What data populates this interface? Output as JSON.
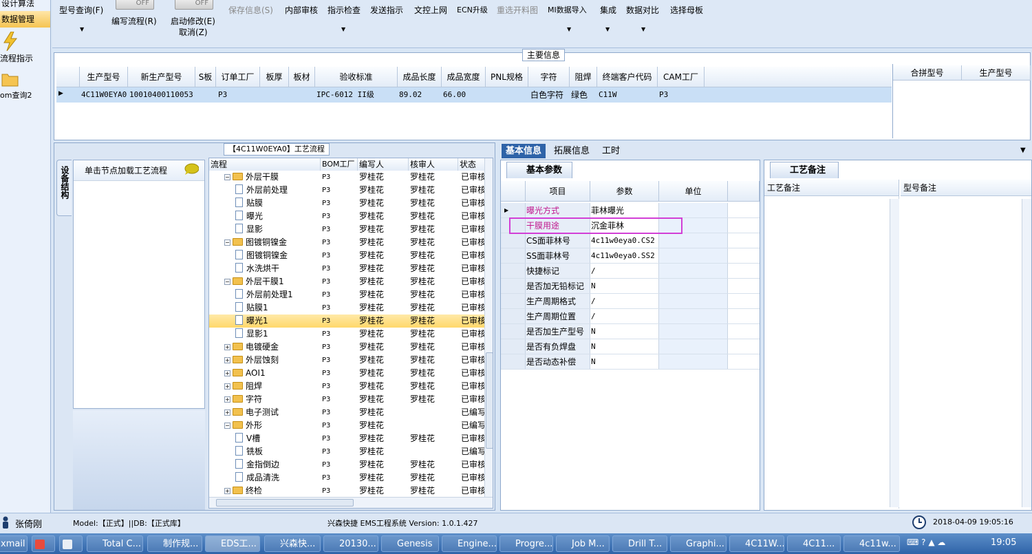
{
  "leftnav": {
    "items": [
      "设计算法",
      "数据管理",
      "流程指示",
      "om查询2"
    ]
  },
  "toolbar": {
    "buttons": [
      "型号查询(F)",
      "编写流程(R)",
      "启动修改(E)",
      "取消(Z)",
      "保存信息(S)",
      "内部审核",
      "指示检查",
      "发送指示",
      "文控上网",
      "ECN升级",
      "重选开料图",
      "MI数据导入",
      "集成",
      "数据对比",
      "选择母板"
    ],
    "toggle_off": "OFF"
  },
  "main_info": {
    "title": "主要信息",
    "columns": [
      "生产型号",
      "新生产型号",
      "S板",
      "订单工厂",
      "板厚",
      "板材",
      "验收标准",
      "成品长度",
      "成品宽度",
      "PNL规格",
      "字符",
      "阻焊",
      "终端客户代码",
      "CAM工厂"
    ],
    "row": [
      "4C11W0EYA0",
      "10010400110053",
      "",
      "P3",
      "",
      "",
      "IPC-6012 II级",
      "89.02",
      "66.00",
      "",
      "白色字符",
      "绿色",
      "C11W",
      "P3"
    ],
    "side_columns": [
      "合拼型号",
      "生产型号"
    ]
  },
  "process": {
    "title": "【4C11W0EYA0】工艺流程",
    "vtab_label": "设备结构",
    "load_hint": "单击节点加载工艺流程",
    "columns": [
      "流程",
      "BOM工厂",
      "编写人",
      "核审人",
      "状态"
    ],
    "rows": [
      {
        "name": "外层干膜",
        "level": 1,
        "bom": "P3",
        "writer": "罗桂花",
        "checker": "罗桂花",
        "status": "已审核"
      },
      {
        "name": "外层前处理",
        "level": 2,
        "bom": "P3",
        "writer": "罗桂花",
        "checker": "罗桂花",
        "status": "已审核"
      },
      {
        "name": "贴膜",
        "level": 2,
        "bom": "P3",
        "writer": "罗桂花",
        "checker": "罗桂花",
        "status": "已审核"
      },
      {
        "name": "曝光",
        "level": 2,
        "bom": "P3",
        "writer": "罗桂花",
        "checker": "罗桂花",
        "status": "已审核"
      },
      {
        "name": "显影",
        "level": 2,
        "bom": "P3",
        "writer": "罗桂花",
        "checker": "罗桂花",
        "status": "已审核"
      },
      {
        "name": "图镀铜镍金",
        "level": 1,
        "bom": "P3",
        "writer": "罗桂花",
        "checker": "罗桂花",
        "status": "已审核"
      },
      {
        "name": "图镀铜镍金",
        "level": 2,
        "bom": "P3",
        "writer": "罗桂花",
        "checker": "罗桂花",
        "status": "已审核"
      },
      {
        "name": "水洗烘干",
        "level": 2,
        "bom": "P3",
        "writer": "罗桂花",
        "checker": "罗桂花",
        "status": "已审核"
      },
      {
        "name": "外层干膜1",
        "level": 1,
        "bom": "P3",
        "writer": "罗桂花",
        "checker": "罗桂花",
        "status": "已审核"
      },
      {
        "name": "外层前处理1",
        "level": 2,
        "bom": "P3",
        "writer": "罗桂花",
        "checker": "罗桂花",
        "status": "已审核"
      },
      {
        "name": "贴膜1",
        "level": 2,
        "bom": "P3",
        "writer": "罗桂花",
        "checker": "罗桂花",
        "status": "已审核"
      },
      {
        "name": "曝光1",
        "level": 2,
        "bom": "P3",
        "writer": "罗桂花",
        "checker": "罗桂花",
        "status": "已审核",
        "selected": true
      },
      {
        "name": "显影1",
        "level": 2,
        "bom": "P3",
        "writer": "罗桂花",
        "checker": "罗桂花",
        "status": "已审核"
      },
      {
        "name": "电镀硬金",
        "level": 1,
        "bom": "P3",
        "writer": "罗桂花",
        "checker": "罗桂花",
        "status": "已审核",
        "collapsed": true
      },
      {
        "name": "外层蚀刻",
        "level": 1,
        "bom": "P3",
        "writer": "罗桂花",
        "checker": "罗桂花",
        "status": "已审核",
        "collapsed": true
      },
      {
        "name": "AOI1",
        "level": 1,
        "bom": "P3",
        "writer": "罗桂花",
        "checker": "罗桂花",
        "status": "已审核",
        "collapsed": true
      },
      {
        "name": "阻焊",
        "level": 1,
        "bom": "P3",
        "writer": "罗桂花",
        "checker": "罗桂花",
        "status": "已审核",
        "collapsed": true
      },
      {
        "name": "字符",
        "level": 1,
        "bom": "P3",
        "writer": "罗桂花",
        "checker": "罗桂花",
        "status": "已审核",
        "collapsed": true
      },
      {
        "name": "电子测试",
        "level": 1,
        "bom": "P3",
        "writer": "罗桂花",
        "checker": "",
        "status": "已编写",
        "collapsed": true
      },
      {
        "name": "外形",
        "level": 1,
        "bom": "P3",
        "writer": "罗桂花",
        "checker": "",
        "status": "已编写"
      },
      {
        "name": "V槽",
        "level": 2,
        "bom": "P3",
        "writer": "罗桂花",
        "checker": "罗桂花",
        "status": "已审核"
      },
      {
        "name": "铣板",
        "level": 2,
        "bom": "P3",
        "writer": "罗桂花",
        "checker": "",
        "status": "已编写"
      },
      {
        "name": "金指倒边",
        "level": 2,
        "bom": "P3",
        "writer": "罗桂花",
        "checker": "罗桂花",
        "status": "已审核"
      },
      {
        "name": "成品清洗",
        "level": 2,
        "bom": "P3",
        "writer": "罗桂花",
        "checker": "罗桂花",
        "status": "已审核"
      },
      {
        "name": "终检",
        "level": 1,
        "bom": "P3",
        "writer": "罗桂花",
        "checker": "罗桂花",
        "status": "已审核",
        "collapsed": true
      }
    ]
  },
  "right_tabs": [
    "基本信息",
    "拓展信息",
    "工时"
  ],
  "basic": {
    "tab": "基本参数",
    "columns": [
      "项目",
      "参数",
      "单位"
    ],
    "rows": [
      {
        "k": "曝光方式",
        "v": "菲林曝光",
        "current": true
      },
      {
        "k": "干膜用途",
        "v": "沉金菲林",
        "highlight": true
      },
      {
        "k": "CS面菲林号",
        "v": "4c11w0eya0.CS2"
      },
      {
        "k": "SS面菲林号",
        "v": "4c11w0eya0.SS2"
      },
      {
        "k": "快捷标记",
        "v": "/"
      },
      {
        "k": "是否加无铅标记",
        "v": "N"
      },
      {
        "k": "生产周期格式",
        "v": "/"
      },
      {
        "k": "生产周期位置",
        "v": "/"
      },
      {
        "k": "是否加生产型号",
        "v": "N"
      },
      {
        "k": "是否有负焊盘",
        "v": "N"
      },
      {
        "k": "是否动态补偿",
        "v": "N"
      }
    ]
  },
  "remarks": {
    "tab": "工艺备注",
    "col1": "工艺备注",
    "col2": "型号备注"
  },
  "status": {
    "user": "张倚刚",
    "model": "Model:【正式】||DB:【正式库】",
    "app": "兴森快捷 EMS工程系统 Version: 1.0.1.427",
    "datetime": "2018-04-09 19:05:16"
  },
  "taskbar": {
    "items": [
      "xmail",
      "",
      "",
      "Total C...",
      "制作规...",
      "EDS工...",
      "兴森快...",
      "20130...",
      "Genesis",
      "Engine...",
      "Progre...",
      "Job M...",
      "Drill T...",
      "Graphi...",
      "4C11W...",
      "4C11...",
      "4c11w..."
    ],
    "clock": "19:05"
  },
  "colors": {
    "accent": "#2e63a8",
    "selected_row": "#ffd86a",
    "highlight_box": "#d23fd6",
    "key_text": "#c0188e"
  }
}
